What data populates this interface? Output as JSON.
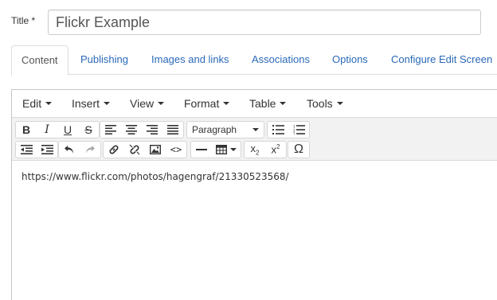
{
  "title_label": "Title *",
  "title_value": "Flickr Example",
  "tabs": [
    {
      "label": "Content"
    },
    {
      "label": "Publishing"
    },
    {
      "label": "Images and links"
    },
    {
      "label": "Associations"
    },
    {
      "label": "Options"
    },
    {
      "label": "Configure Edit Screen"
    }
  ],
  "menu": [
    {
      "label": "Edit"
    },
    {
      "label": "Insert"
    },
    {
      "label": "View"
    },
    {
      "label": "Format"
    },
    {
      "label": "Table"
    },
    {
      "label": "Tools"
    }
  ],
  "toolbar": {
    "bold": "B",
    "italic": "I",
    "underline": "U",
    "strike": "S",
    "block_format": "Paragraph",
    "omega": "Ω",
    "code": "<>"
  },
  "content_text": "https://www.flickr.com/photos/hagengraf/21330523568/",
  "colors": {
    "link": "#2a69b8",
    "border": "#c5c5c5",
    "toolbar_bg": "#f2f2f2"
  }
}
